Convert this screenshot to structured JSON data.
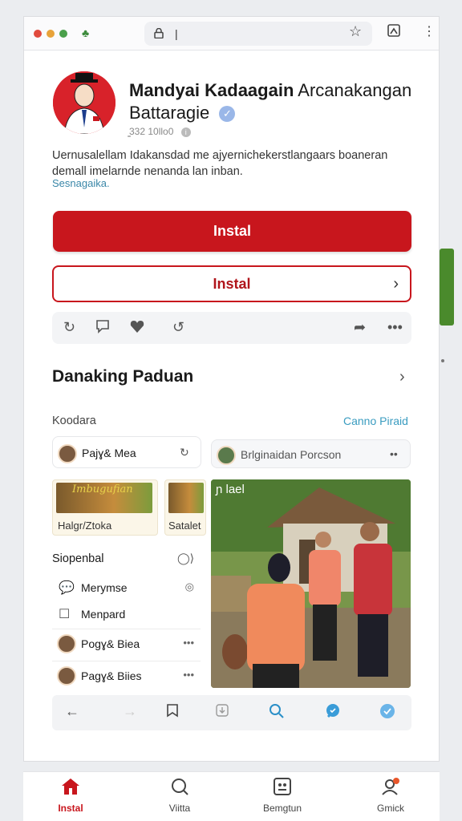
{
  "profile": {
    "name_bold": "Mandyai Kadaagain",
    "name_rest": "Arcanakangan",
    "name_line2": "Battaragie",
    "meta": "̳332 10llo0",
    "description": "Uernusalellam Idakansdad me ajyernichekerstlangaars boaneran demall imelarnde nenanda lan inban.",
    "link": "Sesnagaika."
  },
  "buttons": {
    "primary_label": "Instal",
    "secondary_label": "Instal"
  },
  "section": {
    "title": "Danaking Paduan",
    "sub_left": "Koodara",
    "sub_right": "Canno Piraid"
  },
  "cards": {
    "pill1": "Pajɣ& Mea",
    "pill2": "Brlginaidan Porcson",
    "tile1_caption": "Halgr/Ztoka",
    "tile1_img_text": "Imbugufian",
    "tile2_caption": "Satalet",
    "photo_label": "ɲ lael"
  },
  "list": {
    "head": "Siopenbal",
    "items": [
      {
        "label": "Merymse"
      },
      {
        "label": "Menpard"
      },
      {
        "label": "Pogɣ& Biea"
      },
      {
        "label": "Pagɣ& Biies"
      }
    ]
  },
  "tabs": [
    {
      "label": "Instal"
    },
    {
      "label": "Viitta"
    },
    {
      "label": "Bemgtun"
    },
    {
      "label": "Gmick"
    }
  ],
  "colors": {
    "accent": "#c8161d",
    "link": "#3a9cc0"
  }
}
